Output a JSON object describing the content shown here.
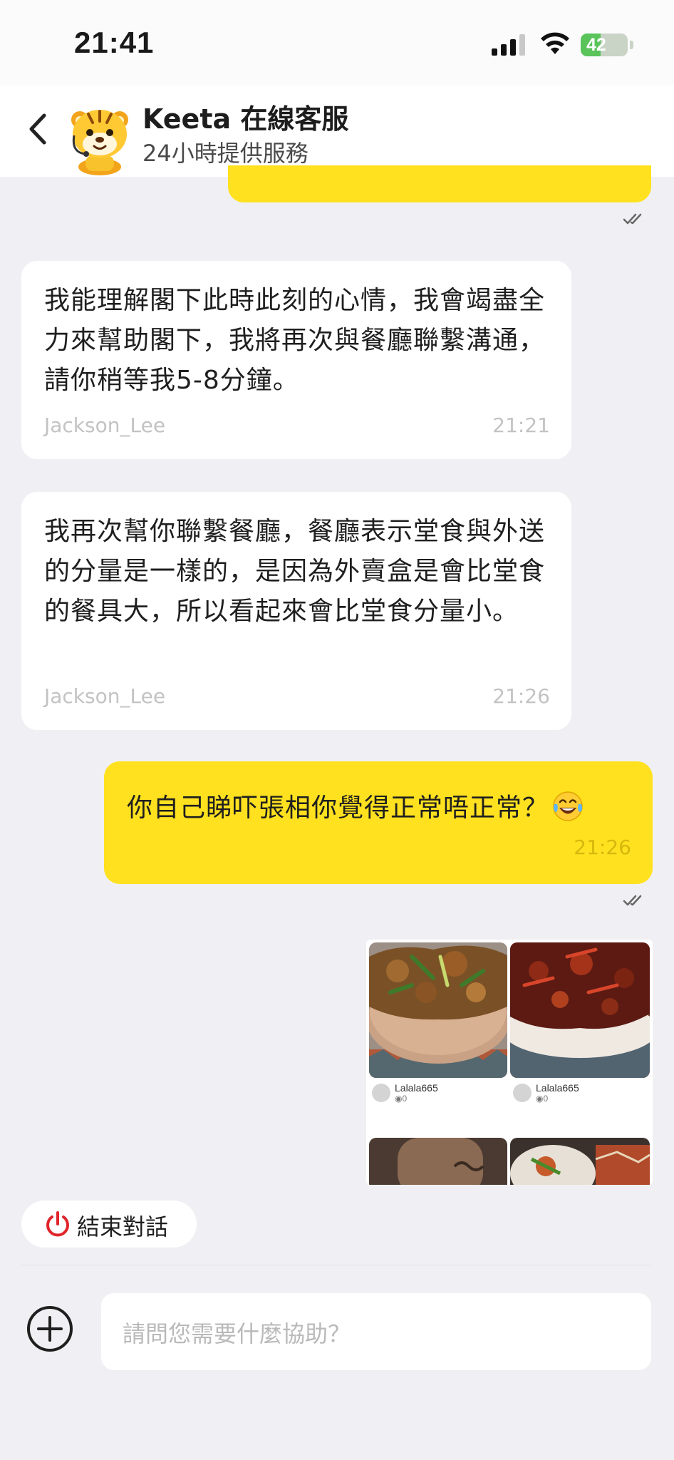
{
  "status_bar": {
    "time": "21:41",
    "battery": "42",
    "battery_level_percent": 42
  },
  "header": {
    "back_icon": "chevron-left-icon",
    "title": "Keeta 在線客服",
    "subtitle": "24小時提供服務"
  },
  "messages": [
    {
      "direction": "incoming",
      "text": "我能理解閣下此時此刻的心情，我會竭盡全力來幫助閣下，我將再次與餐廳聯繫溝通，請你稍等我5-8分鐘。",
      "sender": "Jackson_Lee",
      "time": "21:21"
    },
    {
      "direction": "incoming",
      "text": "我再次幫你聯繫餐廳，餐廳表示堂食與外送的分量是一樣的，是因為外賣盒是會比堂食的餐具大，所以看起來會比堂食分量小。",
      "sender": "Jackson_Lee",
      "time": "21:26"
    },
    {
      "direction": "outgoing",
      "text": "你自己睇吓張相你覺得正常唔正常？",
      "emoji": "laughing-tears-emoji",
      "time": "21:26"
    }
  ],
  "image_message": {
    "photos": [
      {
        "user": "Lalala665",
        "views": "0"
      },
      {
        "user": "Lalala665",
        "views": "0"
      }
    ]
  },
  "footer": {
    "end_chat_label": "結束對話",
    "input_placeholder": "請問您需要什麼協助？"
  },
  "colors": {
    "accent_yellow": "#ffe11f",
    "background": "#f0f0f4",
    "end_chat_red": "#e0252a"
  }
}
